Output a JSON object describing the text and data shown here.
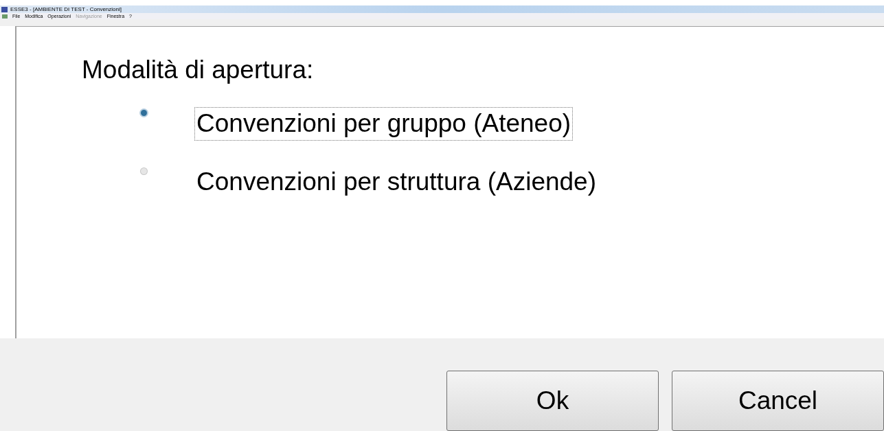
{
  "window": {
    "title": "ESSE3 - [AMBIENTE DI TEST - Convenzioni]"
  },
  "menu": [
    {
      "label": "File",
      "disabled": false
    },
    {
      "label": "Modifica",
      "disabled": false
    },
    {
      "label": "Operazioni",
      "disabled": false
    },
    {
      "label": "Navigazione",
      "disabled": true
    },
    {
      "label": "Finestra",
      "disabled": false
    },
    {
      "label": "?",
      "disabled": false
    }
  ],
  "dialog": {
    "heading": "Modalità di apertura:",
    "options": [
      {
        "label": "Convenzioni per gruppo (Ateneo)",
        "selected": true
      },
      {
        "label": "Convenzioni per struttura (Aziende)",
        "selected": false
      }
    ],
    "buttons": [
      "Ok",
      "Cancel"
    ]
  }
}
